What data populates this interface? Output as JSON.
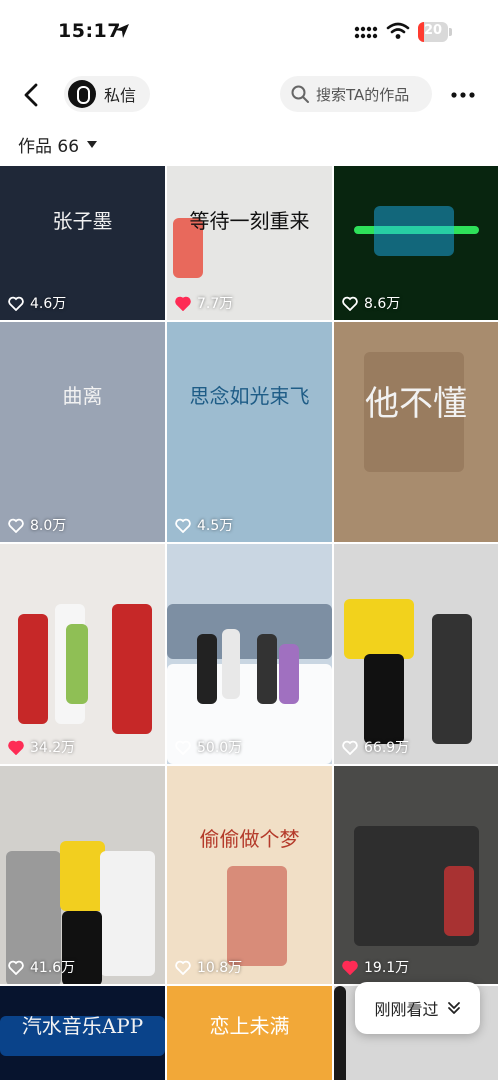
{
  "status_bar": {
    "time": "15:17",
    "battery": "20",
    "battery_level": 0.2
  },
  "nav": {
    "private_message": "私信",
    "search_placeholder": "搜索TA的作品"
  },
  "works": {
    "label": "作品 66"
  },
  "grid": [
    {
      "likes": "4.6万",
      "liked": false,
      "bg": "#1f2838",
      "text": "张子墨"
    },
    {
      "likes": "7.7万",
      "liked": true,
      "bg": "#e6e6e4",
      "text": "等待一刻重来"
    },
    {
      "likes": "8.6万",
      "liked": false,
      "bg": "#08250f",
      "text": ""
    },
    {
      "likes": "8.0万",
      "liked": false,
      "bg": "#9aa4b4",
      "text": "曲离"
    },
    {
      "likes": "4.5万",
      "liked": false,
      "bg": "#9dbcd0",
      "text": "思念如光束飞"
    },
    {
      "likes": "",
      "liked": false,
      "bg": "#a88c6e",
      "text": "他不懂"
    },
    {
      "likes": "34.2万",
      "liked": true,
      "bg": "#ece9e6",
      "text": ""
    },
    {
      "likes": "50.0万",
      "liked": false,
      "bg": "#c9d6e2",
      "text": ""
    },
    {
      "likes": "66.9万",
      "liked": false,
      "bg": "#d8d8d8",
      "text": ""
    },
    {
      "likes": "41.6万",
      "liked": false,
      "bg": "#d2d0cc",
      "text": ""
    },
    {
      "likes": "10.8万",
      "liked": false,
      "bg": "#f1dfc6",
      "text": "偷偷做个梦"
    },
    {
      "likes": "19.1万",
      "liked": true,
      "bg": "#4a4a48",
      "text": ""
    },
    {
      "likes": "",
      "liked": false,
      "bg": "#07142e",
      "text": "汽水音乐APP"
    },
    {
      "likes": "",
      "liked": false,
      "bg": "#f2a838",
      "text": "恋上未满"
    },
    {
      "likes": "",
      "liked": false,
      "bg": "#d7d7d7",
      "text": ""
    }
  ],
  "recent_button": {
    "label": "刚刚看过"
  },
  "colors": {
    "like_red": "#fe2c55",
    "pill_bg": "#f2f2f2"
  }
}
